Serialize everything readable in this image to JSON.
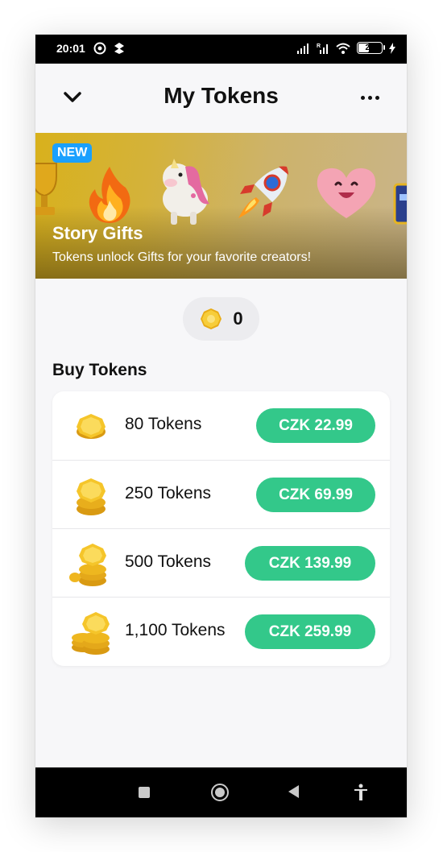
{
  "status_bar": {
    "time": "20:01",
    "battery": "21",
    "icons": [
      "signal-icon",
      "signal-roaming-icon",
      "wifi-icon",
      "battery-icon",
      "charging-icon"
    ]
  },
  "header": {
    "title": "My Tokens",
    "back_icon": "chevron-down-icon",
    "more_icon": "more-dots-icon"
  },
  "banner": {
    "badge": "NEW",
    "title": "Story Gifts",
    "subtitle": "Tokens unlock Gifts for your favorite creators!",
    "gifts": [
      "trophy-icon",
      "fire-icon",
      "unicorn-icon",
      "rocket-icon",
      "heart-face-icon",
      "gift-card-icon"
    ]
  },
  "balance": {
    "value": "0",
    "icon": "token-coin-icon"
  },
  "buy_section": {
    "title": "Buy Tokens",
    "packages": [
      {
        "label": "80 Tokens",
        "price": "CZK 22.99",
        "stack": 1
      },
      {
        "label": "250 Tokens",
        "price": "CZK 69.99",
        "stack": 2
      },
      {
        "label": "500 Tokens",
        "price": "CZK 139.99",
        "stack": 3
      },
      {
        "label": "1,100 Tokens",
        "price": "CZK 259.99",
        "stack": 4
      }
    ]
  },
  "colors": {
    "accent_green": "#33c88a",
    "badge_blue": "#1aa0ff",
    "coin_gold": "#f3c022"
  },
  "nav_bar": {
    "icons": [
      "recents-square-icon",
      "home-circle-icon",
      "back-triangle-icon",
      "accessibility-icon"
    ]
  }
}
